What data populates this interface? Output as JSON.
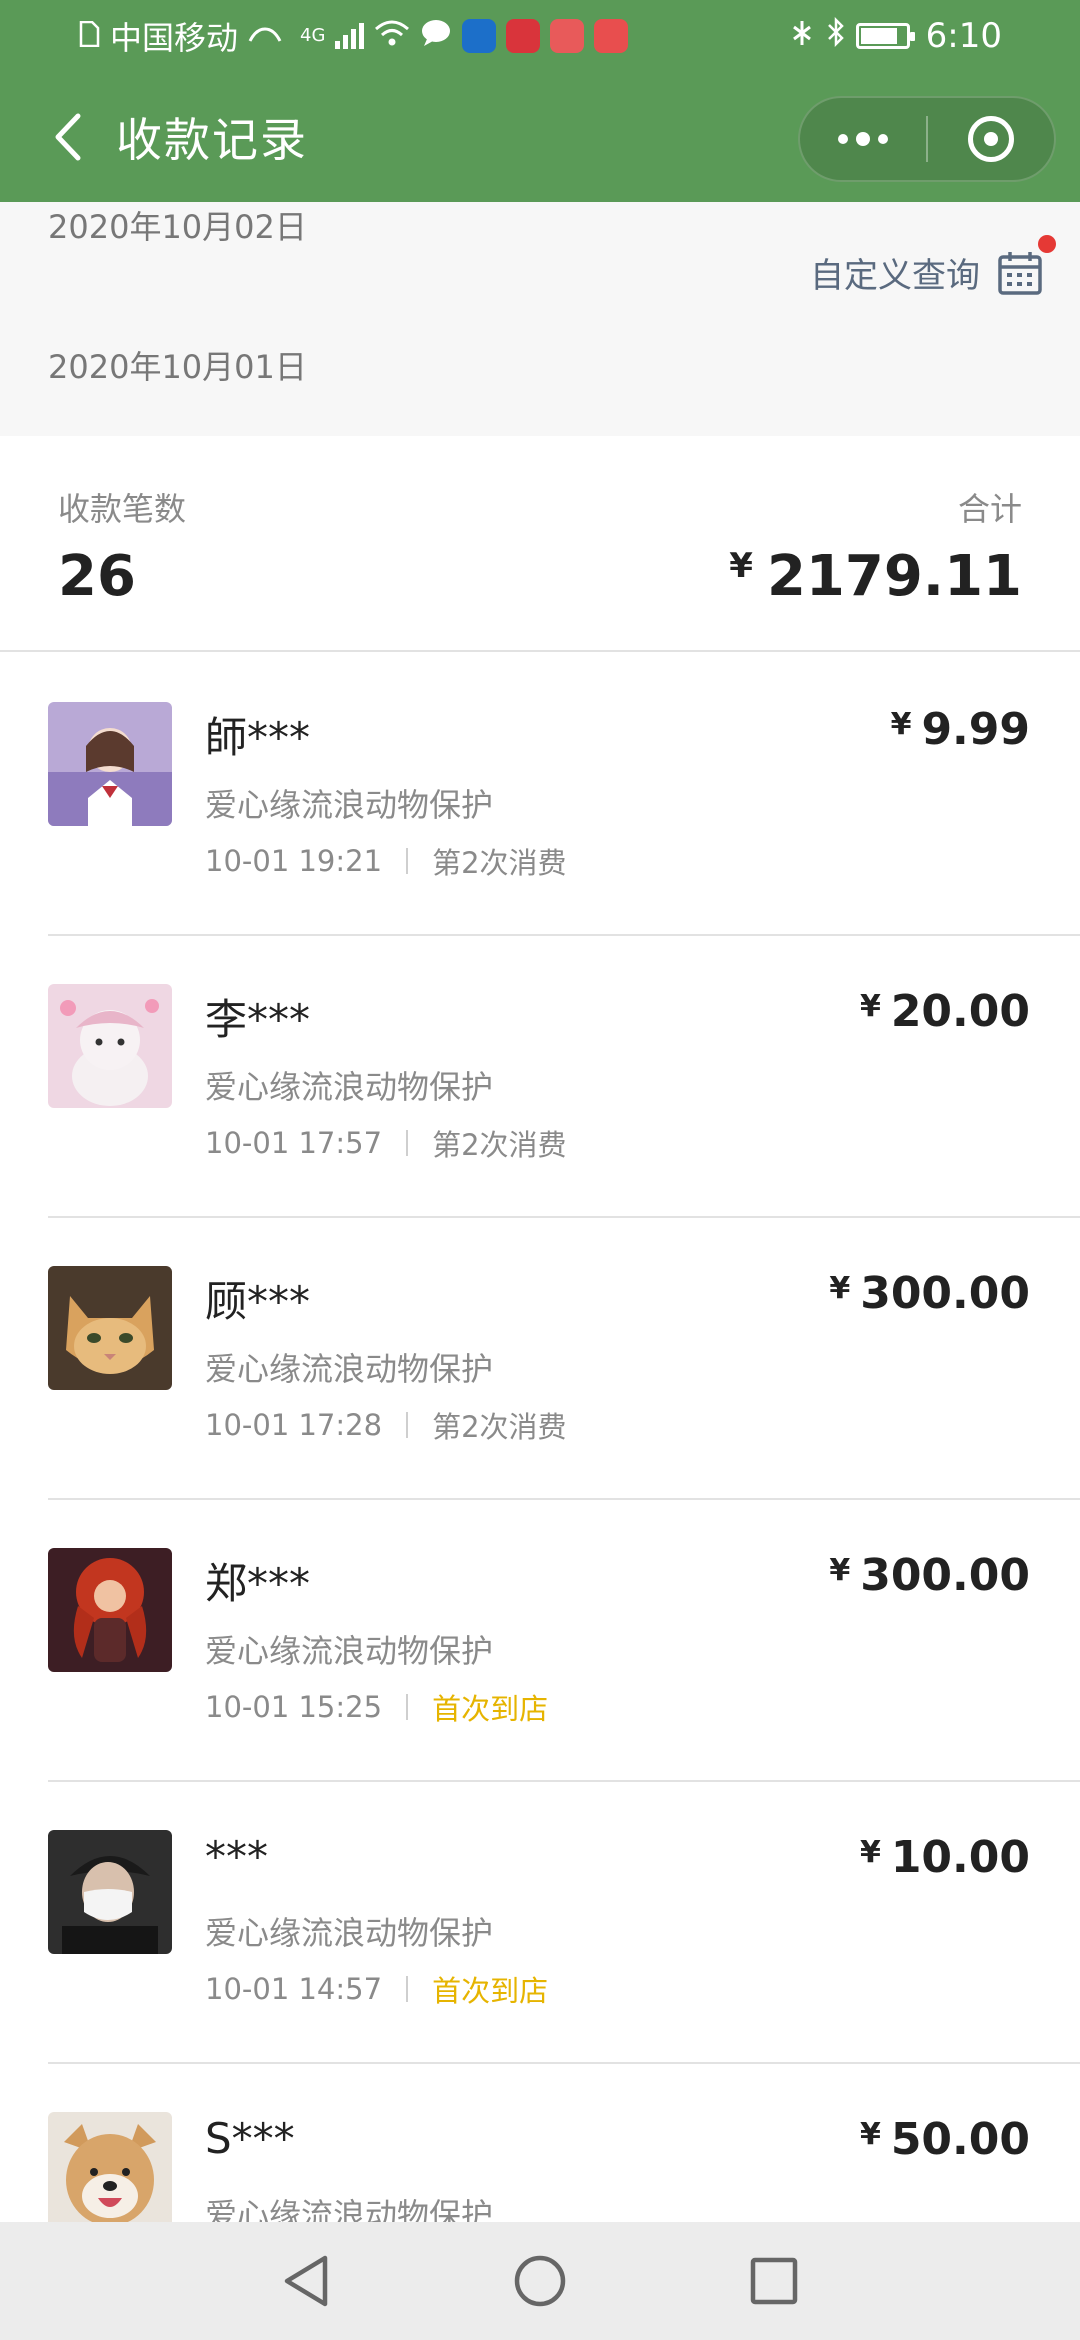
{
  "status_bar": {
    "carrier": "中国移动",
    "network": "4G",
    "time": "6:10",
    "battery_level": 0.85
  },
  "nav": {
    "title": "收款记录"
  },
  "date_filter": {
    "start_date": "2020年10月02日",
    "end_date": "2020年10月01日",
    "custom_query_label": "自定义查询"
  },
  "summary": {
    "count_label": "收款笔数",
    "count": "26",
    "total_label": "合计",
    "currency": "¥",
    "total": "2179.11"
  },
  "records": [
    {
      "name": "師***",
      "shop": "爱心缘流浪动物保护",
      "time": "10-01 19:21",
      "tag": "第2次消费",
      "tag_type": "repeat",
      "currency": "¥",
      "amount": "9.99",
      "avatar": "girl-illustration"
    },
    {
      "name": "李***",
      "shop": "爱心缘流浪动物保护",
      "time": "10-01 17:57",
      "tag": "第2次消费",
      "tag_type": "repeat",
      "currency": "¥",
      "amount": "20.00",
      "avatar": "plush-toy"
    },
    {
      "name": "顾***",
      "shop": "爱心缘流浪动物保护",
      "time": "10-01 17:28",
      "tag": "第2次消费",
      "tag_type": "repeat",
      "currency": "¥",
      "amount": "300.00",
      "avatar": "cat"
    },
    {
      "name": "郑***",
      "shop": "爱心缘流浪动物保护",
      "time": "10-01 15:25",
      "tag": "首次到店",
      "tag_type": "first",
      "currency": "¥",
      "amount": "300.00",
      "avatar": "red-hair-character"
    },
    {
      "name": "***",
      "shop": "爱心缘流浪动物保护",
      "time": "10-01 14:57",
      "tag": "首次到店",
      "tag_type": "first",
      "currency": "¥",
      "amount": "10.00",
      "avatar": "masked-person"
    },
    {
      "name": "S***",
      "shop": "爱心缘流浪动物保护",
      "currency": "¥",
      "amount": "50.00",
      "avatar": "shiba-dog"
    }
  ],
  "colors": {
    "header_green": "#5a9a57",
    "first_visit_tag": "#e6b400",
    "notification_dot": "#e53935"
  }
}
